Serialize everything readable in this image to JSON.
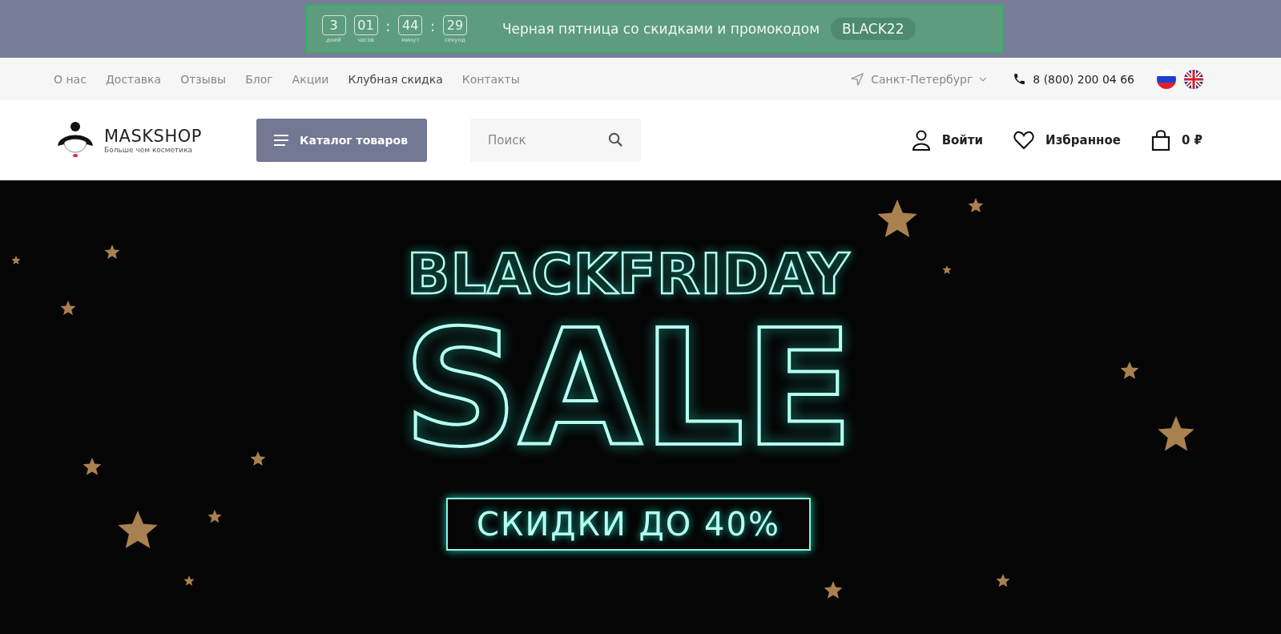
{
  "promo": {
    "timer": [
      {
        "value": "3",
        "unit": "дней"
      },
      {
        "value": "01",
        "unit": "часов"
      },
      {
        "value": "44",
        "unit": "минут"
      },
      {
        "value": "29",
        "unit": "секунд"
      }
    ],
    "separator": ":",
    "message": "Черная пятница со скидками и промокодом",
    "code": "BLACK22"
  },
  "topnav": {
    "links": [
      {
        "label": "О нас",
        "selected": false
      },
      {
        "label": "Доставка",
        "selected": false
      },
      {
        "label": "Отзывы",
        "selected": false
      },
      {
        "label": "Блог",
        "selected": false
      },
      {
        "label": "Акции",
        "selected": false
      },
      {
        "label": "Клубная скидка",
        "selected": true
      },
      {
        "label": "Контакты",
        "selected": false
      }
    ],
    "city": "Санкт-Петербург",
    "phone": "8 (800) 200 04 66"
  },
  "header": {
    "logo": {
      "name": "MASKSHOP",
      "tagline": "Больше чем косметика"
    },
    "catalog_button": "Каталог товаров",
    "search": {
      "placeholder": "Поиск"
    },
    "login": "Войти",
    "favorites": "Избранное",
    "cart": "0 ₽"
  },
  "hero": {
    "title": "BLACKFRIDAY",
    "headline": "SALE",
    "subtitle": "СКИДКИ ДО 40%"
  }
}
